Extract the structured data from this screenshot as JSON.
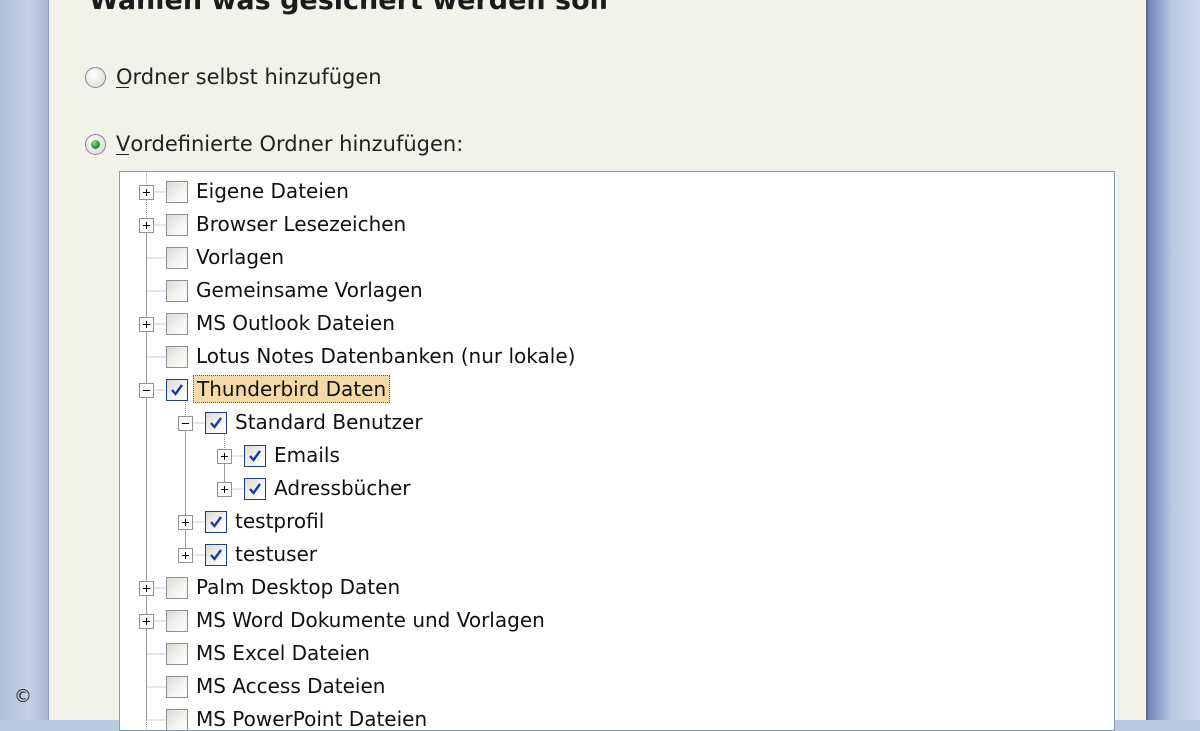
{
  "heading": "Wählen was gesichert werden soll",
  "options": {
    "custom_folder": {
      "accel": "O",
      "rest": "rdner selbst hinzufügen",
      "selected": false
    },
    "predefined_folder": {
      "accel": "V",
      "rest": "ordefinierte Ordner hinzufügen:",
      "selected": true
    }
  },
  "tree": {
    "items": [
      {
        "label": "Eigene Dateien",
        "level": 0,
        "expander": "plus",
        "checked": false
      },
      {
        "label": "Browser Lesezeichen",
        "level": 0,
        "expander": "plus",
        "checked": false
      },
      {
        "label": "Vorlagen",
        "level": 0,
        "expander": "none",
        "checked": false
      },
      {
        "label": "Gemeinsame Vorlagen",
        "level": 0,
        "expander": "none",
        "checked": false
      },
      {
        "label": "MS Outlook Dateien",
        "level": 0,
        "expander": "plus",
        "checked": false
      },
      {
        "label": "Lotus Notes Datenbanken (nur lokale)",
        "level": 0,
        "expander": "none",
        "checked": false
      },
      {
        "label": "Thunderbird Daten",
        "level": 0,
        "expander": "minus",
        "checked": true,
        "selected": true
      },
      {
        "label": "Standard Benutzer",
        "level": 1,
        "expander": "minus",
        "checked": true
      },
      {
        "label": "Emails",
        "level": 2,
        "expander": "plus",
        "checked": true
      },
      {
        "label": "Adressbücher",
        "level": 2,
        "expander": "plus",
        "checked": true
      },
      {
        "label": "testprofil",
        "level": 1,
        "expander": "plus",
        "checked": true
      },
      {
        "label": "testuser",
        "level": 1,
        "expander": "plus",
        "checked": true
      },
      {
        "label": "Palm Desktop Daten",
        "level": 0,
        "expander": "plus",
        "checked": false
      },
      {
        "label": "MS Word Dokumente und Vorlagen",
        "level": 0,
        "expander": "plus",
        "checked": false
      },
      {
        "label": "MS Excel Dateien",
        "level": 0,
        "expander": "none",
        "checked": false
      },
      {
        "label": "MS Access Dateien",
        "level": 0,
        "expander": "none",
        "checked": false
      },
      {
        "label": "MS PowerPoint Dateien",
        "level": 0,
        "expander": "none",
        "checked": false
      }
    ]
  },
  "copyright_symbol": "©",
  "colors": {
    "selection": "#f5d9a6",
    "check": "#1a3aa8",
    "radio_dot": "#2f9a2f"
  },
  "icons": {
    "expand": "plus-box-icon",
    "collapse": "minus-box-icon",
    "checkbox": "checkmark-icon"
  }
}
